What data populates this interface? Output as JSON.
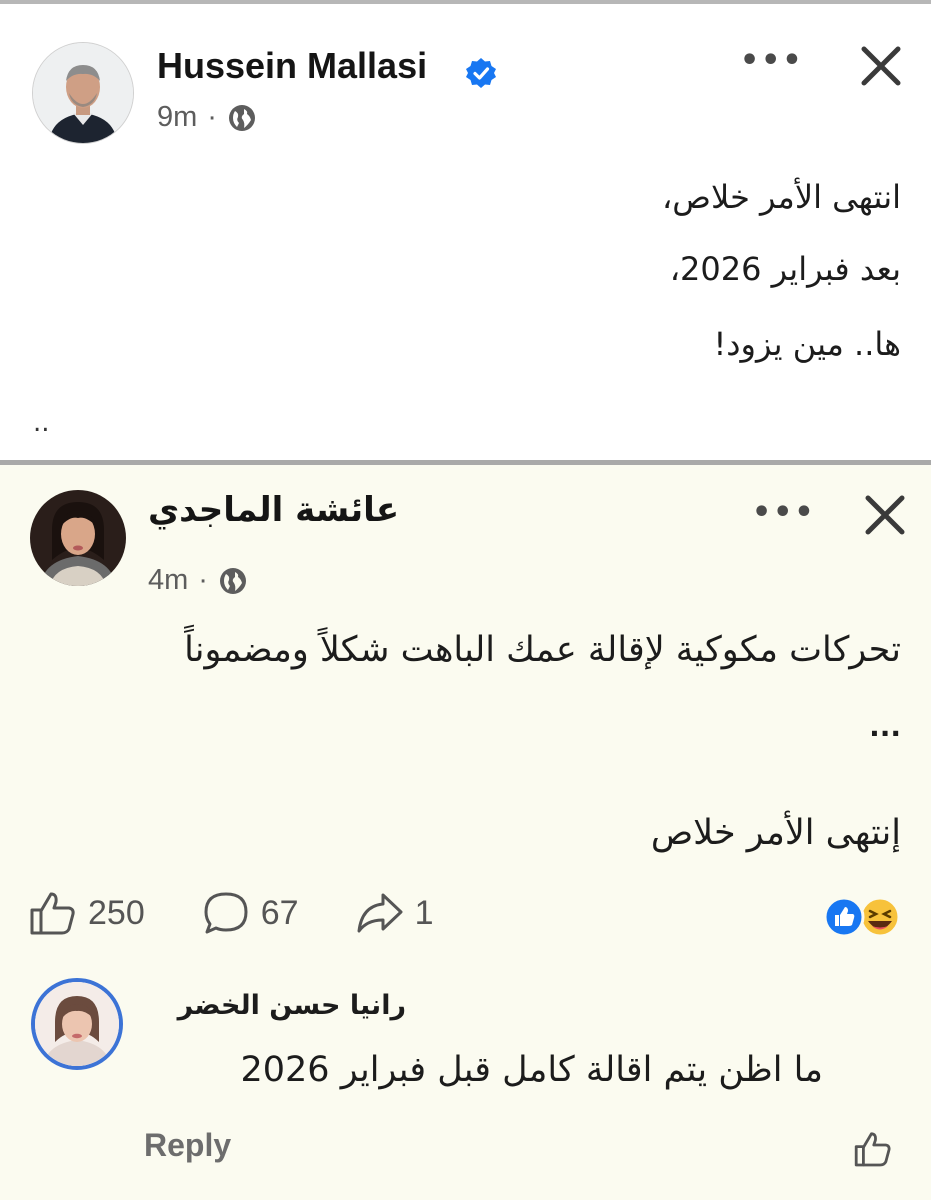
{
  "post": {
    "author": "Hussein Mallasi",
    "time": "9m",
    "lines": [
      "انتهى الأمر خلاص،",
      "بعد فبراير 2026،",
      "ها.. مين يزود!"
    ],
    "trailing": ".."
  },
  "shared_post": {
    "author": "عائشة الماجدي",
    "time": "4m",
    "line1": "تحركات مكوكية لإقالة عمك الباهت شكلاً ومضموناً",
    "line2": "...",
    "line3": "إنتهى الأمر خلاص"
  },
  "stats": {
    "likes": "250",
    "comments": "67",
    "shares": "1"
  },
  "comment": {
    "author": "رانيا حسن الخضر",
    "text": "ما اظن يتم اقالة كامل قبل فبراير 2026",
    "reply_label": "Reply"
  },
  "separator": "·",
  "colors": {
    "verified": "#1877f2",
    "like_reaction": "#1877f2",
    "haha_reaction": "#f7c23b",
    "divider": "#a9a9a9",
    "shared_background": "#fbfbf0"
  },
  "icons": [
    "verified-badge-icon",
    "globe-icon",
    "more-options-icon",
    "close-icon",
    "like-icon",
    "comment-icon",
    "share-icon",
    "like-reaction-icon",
    "haha-reaction-icon"
  ]
}
